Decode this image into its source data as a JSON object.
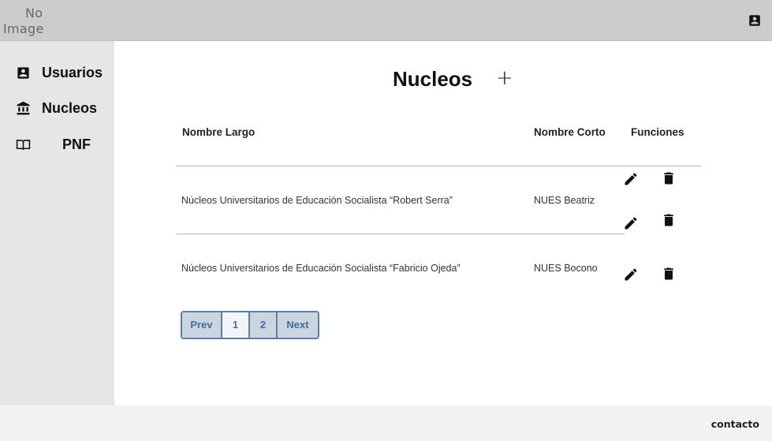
{
  "header": {
    "logo_line1": "No",
    "logo_line2": "Image",
    "profile_icon": "account-box-icon"
  },
  "sidebar": {
    "items": [
      {
        "label": "Usuarios",
        "icon": "account-box-icon"
      },
      {
        "label": "Nucleos",
        "icon": "bank-icon"
      },
      {
        "label": "PNF",
        "icon": "book-open-icon"
      }
    ]
  },
  "main": {
    "title": "Nucleos",
    "add_label": "+",
    "table": {
      "columns": [
        "Nombre Largo",
        "Nombre Corto",
        "Funciones"
      ],
      "rows": [
        {
          "nombre_largo": "Núcleos Universitarios de Educación Socialista “Robert Serra”",
          "nombre_corto": "NUES Beatriz"
        },
        {
          "nombre_largo": "Núcleos Universitarios de Educación Socialista “Fabricio Ojeda”",
          "nombre_corto": "NUES Bocono"
        }
      ]
    },
    "pagination": {
      "prev": "Prev",
      "pages": [
        "1",
        "2"
      ],
      "next": "Next",
      "current": "1"
    }
  },
  "footer": {
    "contact": "contacto"
  },
  "colors": {
    "topbar": "#cccccc",
    "sidebar": "#e6e6e6",
    "footer": "#f2f2f2",
    "pagination_border": "#5b7fa6",
    "pagination_text": "#3d6da3"
  }
}
